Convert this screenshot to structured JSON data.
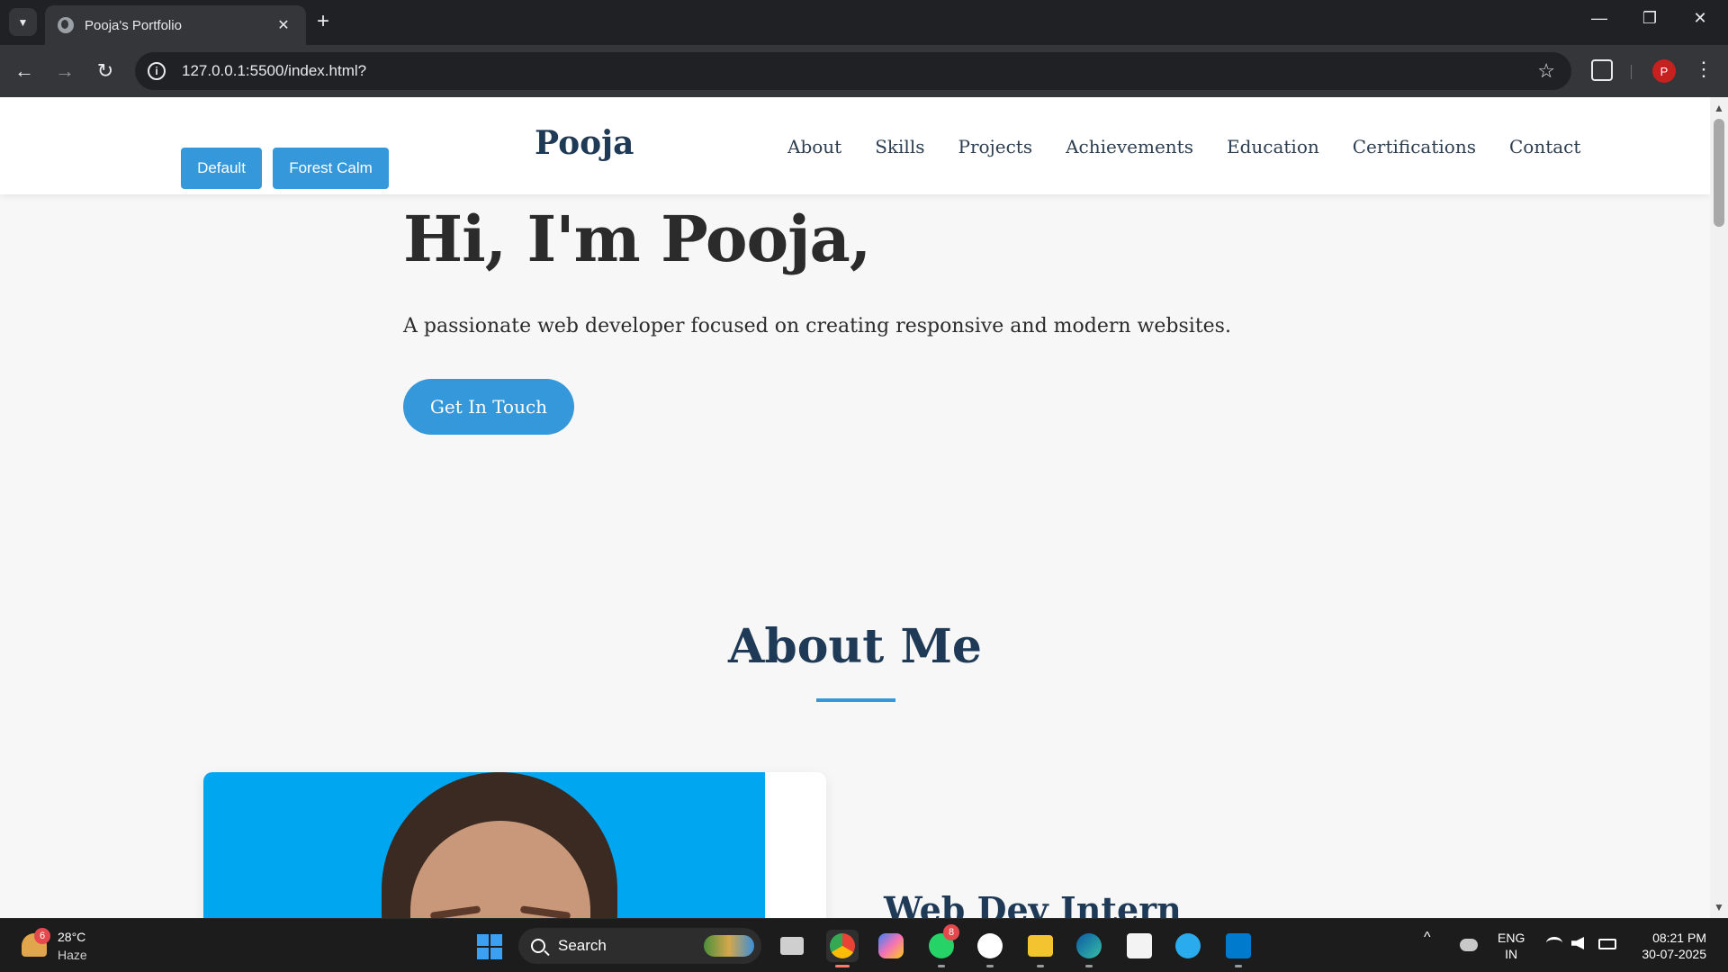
{
  "browser": {
    "tab_title": "Pooja's Portfolio",
    "tab_close": "✕",
    "new_tab": "+",
    "url": "127.0.0.1:5500/index.html?",
    "profile_initial": "P",
    "window_controls": {
      "minimize": "—",
      "restore": "❐",
      "close": "✕"
    },
    "nav": {
      "back": "←",
      "forward": "→",
      "reload": "↻"
    },
    "icons": {
      "site_info": "i",
      "bookmark": "☆",
      "menu": "⋮"
    }
  },
  "site": {
    "theme_buttons": [
      "Default",
      "Forest Calm"
    ],
    "logo": "Pooja",
    "nav_links": [
      "About",
      "Skills",
      "Projects",
      "Achievements",
      "Education",
      "Certifications",
      "Contact"
    ],
    "hero": {
      "title": "Hi, I'm Pooja,",
      "subtitle": "A passionate web developer focused on creating responsive and modern websites.",
      "cta": "Get In Touch"
    },
    "about": {
      "title": "About Me",
      "role": "Web Dev Intern"
    },
    "colors": {
      "accent": "#3498db",
      "heading": "#1f3a56",
      "photo_bg": "#00a7f0"
    }
  },
  "taskbar": {
    "weather": {
      "temp": "28°C",
      "condition": "Haze",
      "badge": "6"
    },
    "search_label": "Search",
    "apps": [
      "task-view",
      "chrome",
      "copilot",
      "whatsapp",
      "github",
      "file-explorer",
      "edge",
      "microsoft-store",
      "telegram",
      "vscode"
    ],
    "whatsapp_badge": "8",
    "language": {
      "line1": "ENG",
      "line2": "IN"
    },
    "clock": {
      "time": "08:21 PM",
      "date": "30-07-2025"
    },
    "tray_chevron": "^"
  }
}
